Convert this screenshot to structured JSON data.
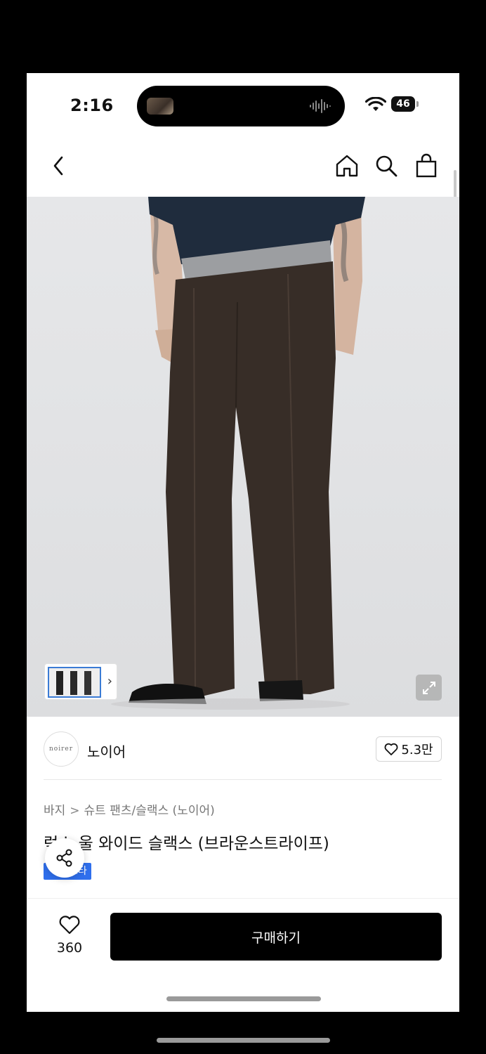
{
  "status_bar": {
    "time": "2:16",
    "battery": "46"
  },
  "nav": {
    "icons": [
      "back-icon",
      "home-icon",
      "search-icon",
      "shopping-bag-icon"
    ]
  },
  "photo": {
    "thumbnail_icon": "chevron-right-icon",
    "expand_icon": "expand-icon"
  },
  "brand": {
    "logo_text": "noirer",
    "name": "노이어",
    "likes": "5.3만"
  },
  "breadcrumb": {
    "category": "바지",
    "subcategory": "슈트 팬츠/슬랙스 (노이어)"
  },
  "product": {
    "title": "럭스 울 와이드 슬랙스 (브라운스트라이프)",
    "tag": "스타"
  },
  "bottom_bar": {
    "wish_count": "360",
    "buy_label": "구매하기"
  },
  "colors": {
    "tag_blue": "#2f6fed",
    "buy_button": "#000000"
  }
}
